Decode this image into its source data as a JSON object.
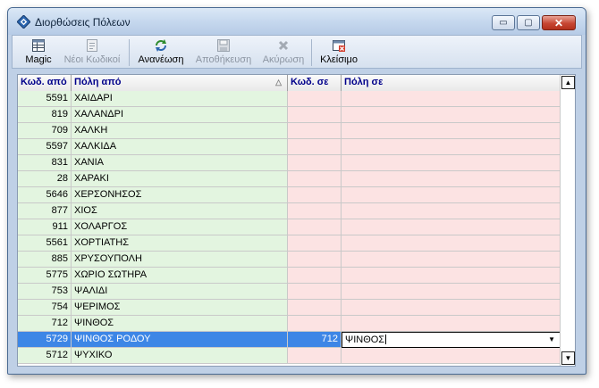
{
  "window": {
    "title": "Διορθώσεις Πόλεων",
    "buttons": {
      "minimize": "▭",
      "maximize": "▢",
      "close": "✕"
    }
  },
  "toolbar": {
    "magic": "Magic",
    "new_codes": "Νέοι Κωδικοί",
    "refresh": "Ανανέωση",
    "save": "Αποθήκευση",
    "cancel": "Ακύρωση",
    "close": "Κλείσιμο"
  },
  "grid": {
    "headers": {
      "code_from": "Κωδ. από",
      "city_from": "Πόλη από",
      "code_to": "Κωδ. σε",
      "city_to": "Πόλη σε"
    },
    "sort_indicator": "△",
    "rows": [
      {
        "code_from": "5591",
        "city_from": "ΧΑΙΔΑΡΙ",
        "code_to": "",
        "city_to": ""
      },
      {
        "code_from": "819",
        "city_from": "ΧΑΛΑΝΔΡΙ",
        "code_to": "",
        "city_to": ""
      },
      {
        "code_from": "709",
        "city_from": "ΧΑΛΚΗ",
        "code_to": "",
        "city_to": ""
      },
      {
        "code_from": "5597",
        "city_from": "ΧΑΛΚΙΔΑ",
        "code_to": "",
        "city_to": ""
      },
      {
        "code_from": "831",
        "city_from": "ΧΑΝΙΑ",
        "code_to": "",
        "city_to": ""
      },
      {
        "code_from": "28",
        "city_from": "ΧΑΡΑΚΙ",
        "code_to": "",
        "city_to": ""
      },
      {
        "code_from": "5646",
        "city_from": "ΧΕΡΣΟΝΗΣΟΣ",
        "code_to": "",
        "city_to": ""
      },
      {
        "code_from": "877",
        "city_from": "ΧΙΟΣ",
        "code_to": "",
        "city_to": ""
      },
      {
        "code_from": "911",
        "city_from": "ΧΟΛΑΡΓΟΣ",
        "code_to": "",
        "city_to": ""
      },
      {
        "code_from": "5561",
        "city_from": "ΧΟΡΤΙΑΤΗΣ",
        "code_to": "",
        "city_to": ""
      },
      {
        "code_from": "885",
        "city_from": "ΧΡΥΣΟΥΠΟΛΗ",
        "code_to": "",
        "city_to": ""
      },
      {
        "code_from": "5775",
        "city_from": "ΧΩΡΙΟ ΣΩΤΗΡΑ",
        "code_to": "",
        "city_to": ""
      },
      {
        "code_from": "753",
        "city_from": "ΨΑΛΙΔΙ",
        "code_to": "",
        "city_to": ""
      },
      {
        "code_from": "754",
        "city_from": "ΨΕΡΙΜΟΣ",
        "code_to": "",
        "city_to": ""
      },
      {
        "code_from": "712",
        "city_from": "ΨΙΝΘΟΣ",
        "code_to": "",
        "city_to": ""
      },
      {
        "code_from": "5729",
        "city_from": "ΨΙΝΘΟΣ ΡΟΔΟΥ",
        "code_to": "712",
        "city_to": "ΨΙΝΘΟΣ",
        "selected": true
      },
      {
        "code_from": "5712",
        "city_from": "ΨΥΧΙΚΟ",
        "code_to": "",
        "city_to": ""
      }
    ]
  },
  "colors": {
    "from_columns": "#e3f5e0",
    "to_columns": "#fce3e3",
    "selection": "#3d86e6",
    "header_text": "#00008a"
  }
}
